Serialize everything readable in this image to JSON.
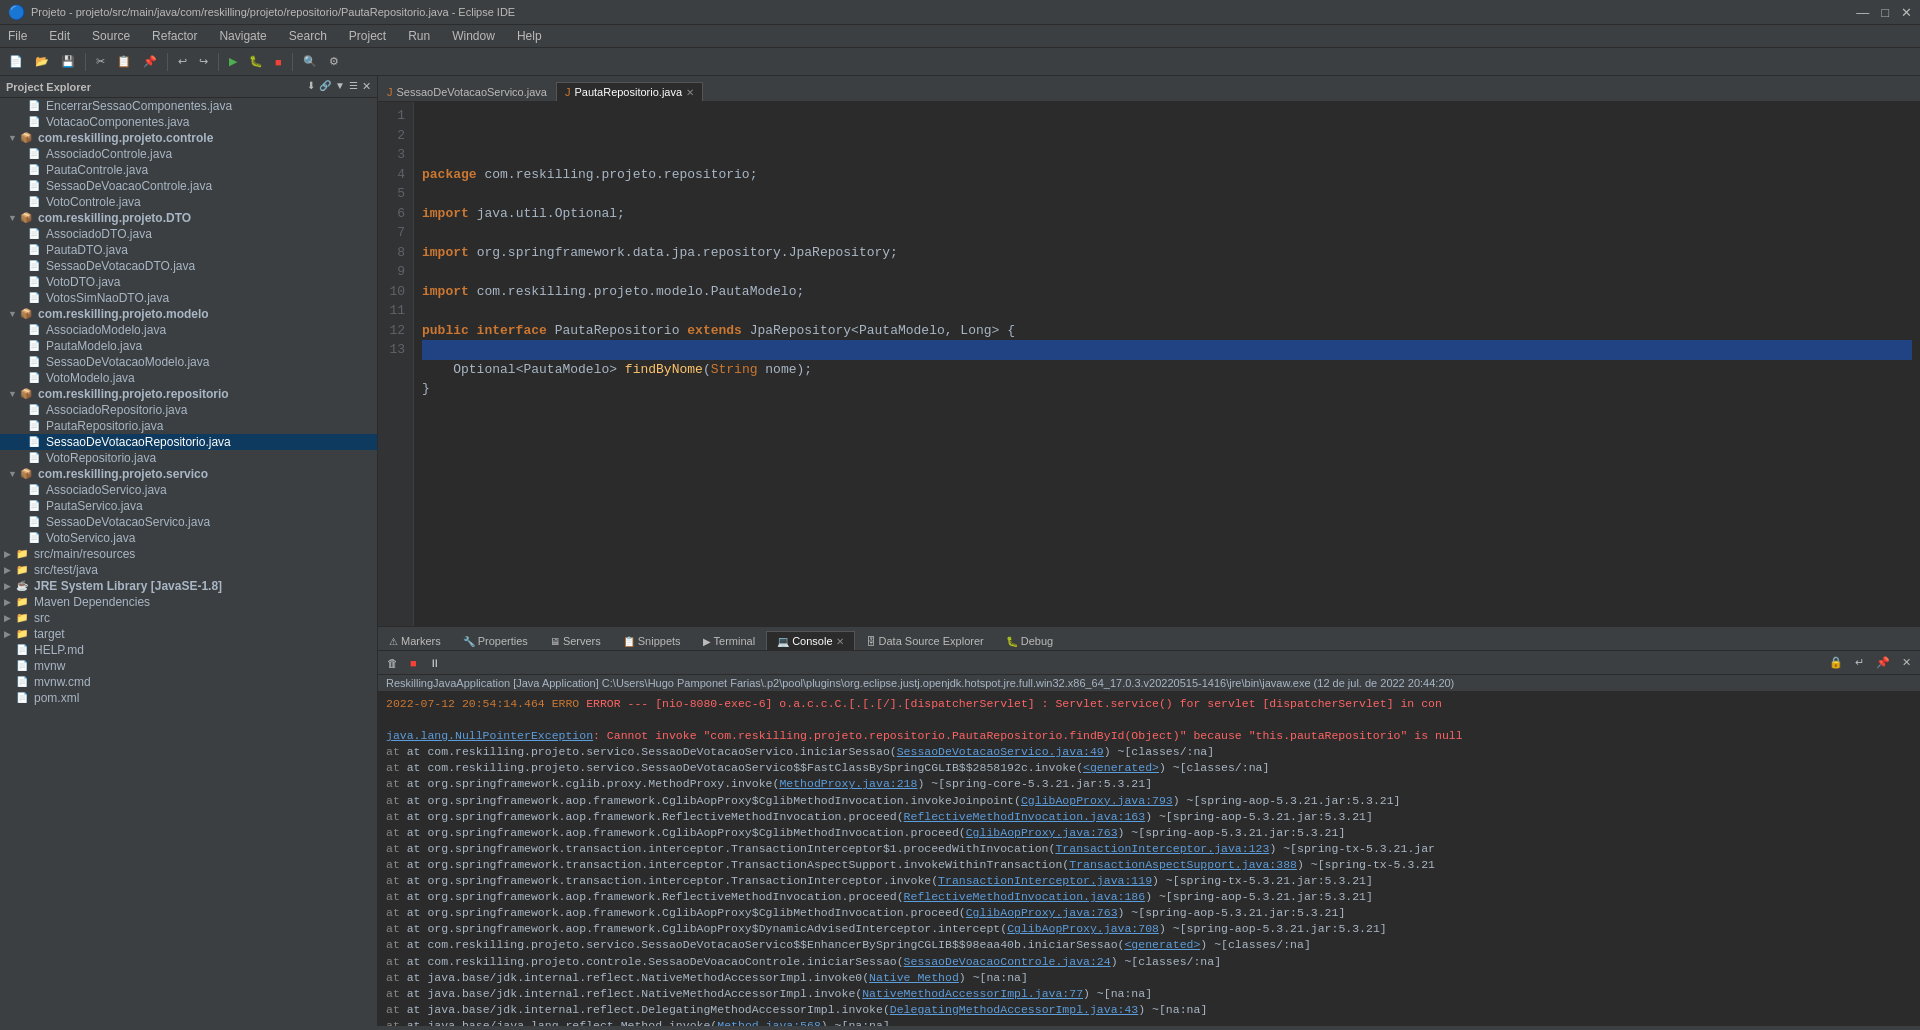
{
  "titleBar": {
    "title": "Projeto - projeto/src/main/java/com/reskilling/projeto/repositorio/PautaRepositorio.java - Eclipse IDE",
    "minimize": "—",
    "maximize": "□",
    "close": "✕"
  },
  "menuBar": {
    "items": [
      "File",
      "Edit",
      "Source",
      "Refactor",
      "Navigate",
      "Search",
      "Project",
      "Run",
      "Window",
      "Help"
    ]
  },
  "projectExplorer": {
    "title": "Project Explorer",
    "closeIcon": "✕",
    "items": [
      {
        "indent": 16,
        "arrow": "",
        "icon": "📄",
        "label": "EncerrarSessaoComponentes.java",
        "type": "java"
      },
      {
        "indent": 16,
        "arrow": "",
        "icon": "📄",
        "label": "VotacaoComponentes.java",
        "type": "java"
      },
      {
        "indent": 8,
        "arrow": "▼",
        "icon": "📦",
        "label": "com.reskilling.projeto.controle",
        "type": "package",
        "expanded": true
      },
      {
        "indent": 16,
        "arrow": "",
        "icon": "📄",
        "label": "AssociadoControle.java",
        "type": "java"
      },
      {
        "indent": 16,
        "arrow": "",
        "icon": "📄",
        "label": "PautaControle.java",
        "type": "java"
      },
      {
        "indent": 16,
        "arrow": "",
        "icon": "📄",
        "label": "SessaoDeVoacaoControle.java",
        "type": "java"
      },
      {
        "indent": 16,
        "arrow": "",
        "icon": "📄",
        "label": "VotoControle.java",
        "type": "java"
      },
      {
        "indent": 8,
        "arrow": "▼",
        "icon": "📦",
        "label": "com.reskilling.projeto.DTO",
        "type": "package",
        "expanded": true
      },
      {
        "indent": 16,
        "arrow": "",
        "icon": "📄",
        "label": "AssociadoDTO.java",
        "type": "java"
      },
      {
        "indent": 16,
        "arrow": "",
        "icon": "📄",
        "label": "PautaDTO.java",
        "type": "java"
      },
      {
        "indent": 16,
        "arrow": "",
        "icon": "📄",
        "label": "SessaoDeVotacaoDTO.java",
        "type": "java"
      },
      {
        "indent": 16,
        "arrow": "",
        "icon": "📄",
        "label": "VotoDTO.java",
        "type": "java"
      },
      {
        "indent": 16,
        "arrow": "",
        "icon": "📄",
        "label": "VotosSimNaoDTO.java",
        "type": "java"
      },
      {
        "indent": 8,
        "arrow": "▼",
        "icon": "📦",
        "label": "com.reskilling.projeto.modelo",
        "type": "package",
        "expanded": true
      },
      {
        "indent": 16,
        "arrow": "",
        "icon": "📄",
        "label": "AssociadoModelo.java",
        "type": "java"
      },
      {
        "indent": 16,
        "arrow": "",
        "icon": "📄",
        "label": "PautaModelo.java",
        "type": "java"
      },
      {
        "indent": 16,
        "arrow": "",
        "icon": "📄",
        "label": "SessaoDeVotacaoModelo.java",
        "type": "java"
      },
      {
        "indent": 16,
        "arrow": "",
        "icon": "📄",
        "label": "VotoModelo.java",
        "type": "java"
      },
      {
        "indent": 8,
        "arrow": "▼",
        "icon": "📦",
        "label": "com.reskilling.projeto.repositorio",
        "type": "package",
        "expanded": true
      },
      {
        "indent": 16,
        "arrow": "",
        "icon": "📄",
        "label": "AssociadoRepositorio.java",
        "type": "java"
      },
      {
        "indent": 16,
        "arrow": "",
        "icon": "📄",
        "label": "PautaRepositorio.java",
        "type": "java"
      },
      {
        "indent": 16,
        "arrow": "",
        "icon": "📄",
        "label": "SessaoDeVotacaoRepositorio.java",
        "type": "java",
        "selected": true
      },
      {
        "indent": 16,
        "arrow": "",
        "icon": "📄",
        "label": "VotoRepositorio.java",
        "type": "java"
      },
      {
        "indent": 8,
        "arrow": "▼",
        "icon": "📦",
        "label": "com.reskilling.projeto.servico",
        "type": "package",
        "expanded": true
      },
      {
        "indent": 16,
        "arrow": "",
        "icon": "📄",
        "label": "AssociadoServico.java",
        "type": "java"
      },
      {
        "indent": 16,
        "arrow": "",
        "icon": "📄",
        "label": "PautaServico.java",
        "type": "java"
      },
      {
        "indent": 16,
        "arrow": "",
        "icon": "📄",
        "label": "SessaoDeVotacaoServico.java",
        "type": "java"
      },
      {
        "indent": 16,
        "arrow": "",
        "icon": "📄",
        "label": "VotoServico.java",
        "type": "java"
      },
      {
        "indent": 4,
        "arrow": "▶",
        "icon": "📁",
        "label": "src/main/resources",
        "type": "folder"
      },
      {
        "indent": 4,
        "arrow": "▶",
        "icon": "📁",
        "label": "src/test/java",
        "type": "folder"
      },
      {
        "indent": 4,
        "arrow": "▶",
        "icon": "☕",
        "label": "JRE System Library [JavaSE-1.8]",
        "type": "lib"
      },
      {
        "indent": 4,
        "arrow": "▶",
        "icon": "📦",
        "label": "Maven Dependencies",
        "type": "folder"
      },
      {
        "indent": 4,
        "arrow": "▶",
        "icon": "📁",
        "label": "src",
        "type": "folder"
      },
      {
        "indent": 4,
        "arrow": "▶",
        "icon": "📁",
        "label": "target",
        "type": "folder"
      },
      {
        "indent": 4,
        "arrow": "",
        "icon": "📄",
        "label": "HELP.md",
        "type": "file"
      },
      {
        "indent": 4,
        "arrow": "",
        "icon": "📄",
        "label": "mvnw",
        "type": "file"
      },
      {
        "indent": 4,
        "arrow": "",
        "icon": "📄",
        "label": "mvnw.cmd",
        "type": "file"
      },
      {
        "indent": 4,
        "arrow": "",
        "icon": "📄",
        "label": "pom.xml",
        "type": "file"
      }
    ]
  },
  "editorTabs": [
    {
      "label": "SessaoDeVotacaoServico.java",
      "active": false,
      "icon": "📄"
    },
    {
      "label": "PautaRepositorio.java",
      "active": true,
      "icon": "📄"
    }
  ],
  "codeLines": [
    {
      "num": 1,
      "text": "package com.reskilling.projeto.repositorio;"
    },
    {
      "num": 2,
      "text": ""
    },
    {
      "num": 3,
      "text": "import java.util.Optional;"
    },
    {
      "num": 4,
      "text": ""
    },
    {
      "num": 5,
      "text": "import org.springframework.data.jpa.repository.JpaRepository;"
    },
    {
      "num": 6,
      "text": ""
    },
    {
      "num": 7,
      "text": "import com.reskilling.projeto.modelo.PautaModelo;"
    },
    {
      "num": 8,
      "text": ""
    },
    {
      "num": 9,
      "text": "public interface PautaRepositorio extends JpaRepository<PautaModelo, Long> {"
    },
    {
      "num": 10,
      "text": "",
      "highlighted": true
    },
    {
      "num": 11,
      "text": "    Optional<PautaModelo> findByNome(String nome);"
    },
    {
      "num": 12,
      "text": "}"
    },
    {
      "num": 13,
      "text": ""
    }
  ],
  "bottomPanel": {
    "tabs": [
      "Markers",
      "Properties",
      "Servers",
      "Snippets",
      "Terminal",
      "Console",
      "Data Source Explorer",
      "Debug"
    ],
    "activeTab": "Console",
    "consoleHeader": "ReskillingJavaApplication [Java Application] C:\\Users\\Hugo Pamponet Farias\\.p2\\pool\\plugins\\org.eclipse.justj.openjdk.hotspot.jre.full.win32.x86_64_17.0.3.v20220515-1416\\jre\\bin\\javaw.exe (12 de jul. de 2022 20:44:20)",
    "consoleLines": [
      {
        "type": "error",
        "text": "2022-07-12 20:54:14.464 ERROR 10220 --- [nio-8080-exec-6] o.a.c.c.C.[.[.[/].[dispatcherServlet]    : Servlet.service() for servlet [dispatcherServlet] in con"
      },
      {
        "type": "blank"
      },
      {
        "type": "exception",
        "text": "java.lang.NullPointerException: Cannot invoke \"com.reskilling.projeto.repositorio.PautaRepositorio.findById(Object)\" because \"this.pautaRepositorio\" is null"
      },
      {
        "type": "stack",
        "text": "at com.reskilling.projeto.servico.SessaoDeVotacaoServico.iniciarSessao(",
        "link": "SessaoDeVotacaoServico.java:49",
        "suffix": ") ~[classes/:na]"
      },
      {
        "type": "stack",
        "text": "at com.reskilling.projeto.servico.SessaoDeVotacaoServico$$FastClassBySpringCGLIB$$2858192c.invoke(",
        "link": "<generated>",
        "suffix": ") ~[classes/:na]"
      },
      {
        "type": "stack",
        "text": "at org.springframework.cglib.proxy.MethodProxy.invoke(",
        "link": "MethodProxy.java:218",
        "suffix": ") ~[spring-core-5.3.21.jar:5.3.21]"
      },
      {
        "type": "stack",
        "text": "at org.springframework.aop.framework.CglibAopProxy$CglibMethodInvocation.invokeJoinpoint(",
        "link": "CglibAopProxy.java:793",
        "suffix": ") ~[spring-aop-5.3.21.jar:5.3.21]"
      },
      {
        "type": "stack",
        "text": "at org.springframework.aop.framework.ReflectiveMethodInvocation.proceed(",
        "link": "ReflectiveMethodInvocation.java:163",
        "suffix": ") ~[spring-aop-5.3.21.jar:5.3.21]"
      },
      {
        "type": "stack",
        "text": "at org.springframework.aop.framework.CglibAopProxy$CglibMethodInvocation.proceed(",
        "link": "CglibAopProxy.java:763",
        "suffix": ") ~[spring-aop-5.3.21.jar:5.3.21]"
      },
      {
        "type": "stack",
        "text": "at org.springframework.transaction.interceptor.TransactionInterceptor$1.proceedWithInvocation(",
        "link": "TransactionInterceptor.java:123",
        "suffix": ") ~[spring-tx-5.3.21.jar"
      },
      {
        "type": "stack",
        "text": "at org.springframework.transaction.interceptor.TransactionAspectSupport.invokeWithinTransaction(",
        "link": "TransactionAspectSupport.java:388",
        "suffix": ") ~[spring-tx-5.3.21"
      },
      {
        "type": "stack",
        "text": "at org.springframework.transaction.interceptor.TransactionInterceptor.invoke(",
        "link": "TransactionInterceptor.java:119",
        "suffix": ") ~[spring-tx-5.3.21.jar:5.3.21]"
      },
      {
        "type": "stack",
        "text": "at org.springframework.aop.framework.ReflectiveMethodInvocation.proceed(",
        "link": "ReflectiveMethodInvocation.java:186",
        "suffix": ") ~[spring-aop-5.3.21.jar:5.3.21]"
      },
      {
        "type": "stack",
        "text": "at org.springframework.aop.framework.CglibAopProxy$CglibMethodInvocation.proceed(",
        "link": "CglibAopProxy.java:763",
        "suffix": ") ~[spring-aop-5.3.21.jar:5.3.21]"
      },
      {
        "type": "stack",
        "text": "at org.springframework.aop.framework.CglibAopProxy$DynamicAdvisedInterceptor.intercept(",
        "link": "CglibAopProxy.java:708",
        "suffix": ") ~[spring-aop-5.3.21.jar:5.3.21]"
      },
      {
        "type": "stack",
        "text": "at com.reskilling.projeto.servico.SessaoDeVotacaoServico$$EnhancerBySpringCGLIB$$98eaa40b.iniciarSessao(",
        "link": "<generated>",
        "suffix": ") ~[classes/:na]"
      },
      {
        "type": "stack",
        "text": "at com.reskilling.projeto.controle.SessaoDeVoacaoControle.iniciarSessao(",
        "link": "SessaoDeVoacaoControle.java:24",
        "suffix": ") ~[classes/:na]"
      },
      {
        "type": "stack",
        "text": "at java.base/jdk.internal.reflect.NativeMethodAccessorImpl.invoke0(",
        "link": "Native Method",
        "suffix": ") ~[na:na]"
      },
      {
        "type": "stack",
        "text": "at java.base/jdk.internal.reflect.NativeMethodAccessorImpl.invoke(",
        "link": "NativeMethodAccessorImpl.java:77",
        "suffix": ") ~[na:na]"
      },
      {
        "type": "stack",
        "text": "at java.base/jdk.internal.reflect.DelegatingMethodAccessorImpl.invoke(",
        "link": "DelegatingMethodAccessorImpl.java:43",
        "suffix": ") ~[na:na]"
      },
      {
        "type": "stack",
        "text": "at java.base/java.lang.reflect.Method.invoke(",
        "link": "Method.java:568",
        "suffix": ") ~[na:na]"
      }
    ]
  }
}
